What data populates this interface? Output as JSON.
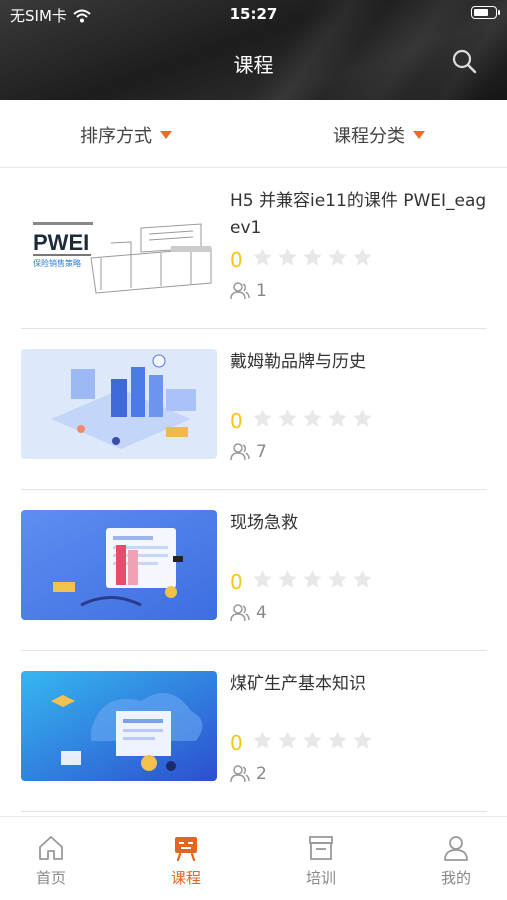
{
  "status_bar": {
    "carrier": "无SIM卡",
    "time": "15:27"
  },
  "header": {
    "title": "课程"
  },
  "filters": {
    "sort_label": "排序方式",
    "category_label": "课程分类"
  },
  "courses": [
    {
      "title": "H5 并兼容ie11的课件 PWEI_eagev1",
      "score": "0",
      "learners": "1",
      "thumb_text": "PWEI",
      "thumb_caption": "保险销售策略"
    },
    {
      "title": "戴姆勒品牌与历史",
      "score": "0",
      "learners": "7"
    },
    {
      "title": "现场急救",
      "score": "0",
      "learners": "4"
    },
    {
      "title": "煤矿生产基本知识",
      "score": "0",
      "learners": "2"
    }
  ],
  "tabs": [
    {
      "label": "首页",
      "icon": "home-icon"
    },
    {
      "label": "课程",
      "icon": "course-icon"
    },
    {
      "label": "培训",
      "icon": "training-icon"
    },
    {
      "label": "我的",
      "icon": "profile-icon"
    }
  ],
  "colors": {
    "accent": "#e4661e",
    "star_empty": "#e8e8e8",
    "score": "#f5c518"
  }
}
